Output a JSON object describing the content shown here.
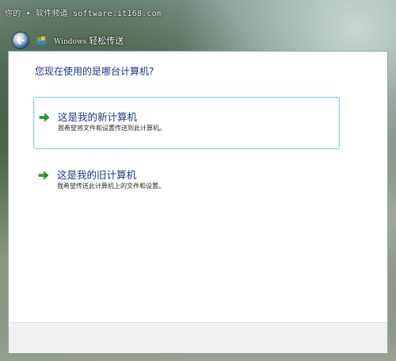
{
  "watermark": "你的 • 软件频道 software.it168.com",
  "window": {
    "title_prefix": "Windows",
    "title": "轻松传送"
  },
  "icons": {
    "back": "back-arrow-icon",
    "app": "easy-transfer-icon",
    "option_arrow": "green-arrow-icon"
  },
  "colors": {
    "question_text": "#1e3287",
    "option_title": "#1a3a8a",
    "arrow_green": "#2e9b2b",
    "selected_border": "#7ad3e9"
  },
  "question": "您现在使用的是哪台计算机?",
  "options": [
    {
      "title": "这是我的新计算机",
      "description": "我希望将文件和设置传送到此计算机。",
      "selected": true
    },
    {
      "title": "这是我的旧计算机",
      "description": "我希望传送此计算机上的文件和设置。",
      "selected": false
    }
  ]
}
